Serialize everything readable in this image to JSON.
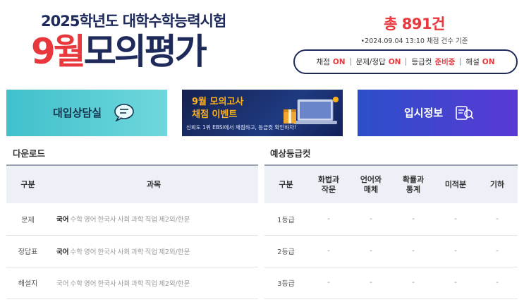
{
  "header": {
    "subtitle": "2025학년도 대학수학능력시험",
    "title_red": "9월",
    "title_navy": "모의평가"
  },
  "summary": {
    "total": "총 891건",
    "basis": "•2024.09.04 13:10 채점 건수 기준",
    "statuses": [
      {
        "label": "채점",
        "value": "ON"
      },
      {
        "label": "문제/정답",
        "value": "ON"
      },
      {
        "label": "등급컷",
        "value": "준비중"
      },
      {
        "label": "해설",
        "value": "ON"
      }
    ]
  },
  "banners": {
    "consult": {
      "text": "대입상담실",
      "icon": "chat-bubble-icon"
    },
    "event": {
      "line1": "9월 모의고사",
      "line2": "채점 이벤트",
      "line3": "신뢰도 1위 EBSi에서 채점하고, 등급컷 확인하자!"
    },
    "info": {
      "text": "입시정보",
      "icon": "search-document-icon"
    }
  },
  "download": {
    "title": "다운로드",
    "headers": [
      "구분",
      "과목"
    ],
    "subjects": [
      "국어",
      "수학",
      "영어",
      "한국사",
      "사회",
      "과학",
      "직업",
      "제2외/한문"
    ],
    "rows": [
      {
        "label": "문제",
        "active_first": true
      },
      {
        "label": "정답표",
        "active_first": true
      },
      {
        "label": "해설지",
        "active_first": false
      }
    ]
  },
  "grades": {
    "title": "예상등급컷",
    "headers": [
      "구분",
      "화법과\n작문",
      "언어와\n매체",
      "확률과\n통계",
      "미적분",
      "기하"
    ],
    "rows": [
      {
        "label": "1등급",
        "values": [
          "-",
          "-",
          "-",
          "-",
          "-"
        ]
      },
      {
        "label": "2등급",
        "values": [
          "-",
          "-",
          "-",
          "-",
          "-"
        ]
      },
      {
        "label": "3등급",
        "values": [
          "-",
          "-",
          "-",
          "-",
          "-"
        ]
      }
    ]
  },
  "colors": {
    "accent_red": "#e8383d",
    "navy": "#1e2a5a"
  }
}
